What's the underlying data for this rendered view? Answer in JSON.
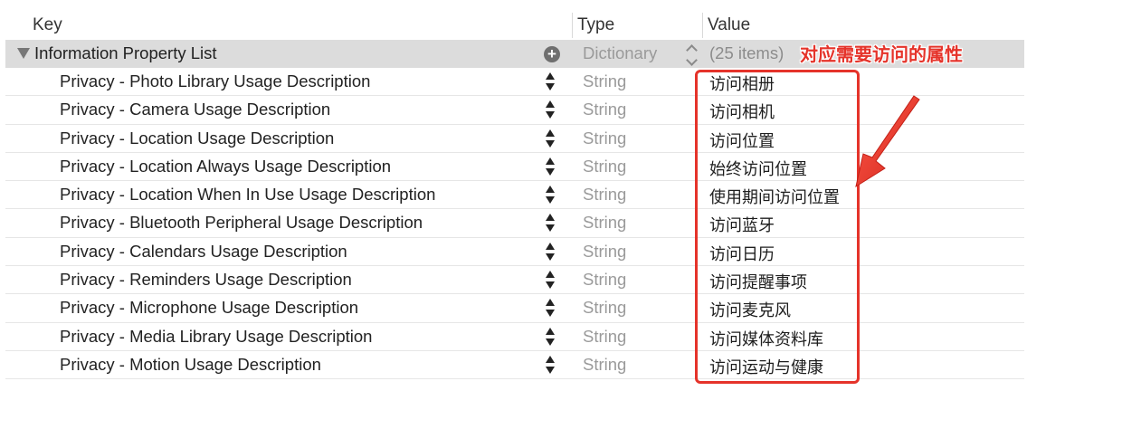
{
  "header": {
    "key": "Key",
    "type": "Type",
    "value": "Value"
  },
  "root": {
    "key": "Information Property List",
    "type": "Dictionary",
    "value": "(25 items)",
    "add_icon": "plus-circle-icon",
    "disclosure_icon": "disclosure-triangle-down-icon"
  },
  "rows": [
    {
      "key": "Privacy - Photo Library Usage Description",
      "type": "String",
      "value": "访问相册"
    },
    {
      "key": "Privacy - Camera Usage Description",
      "type": "String",
      "value": "访问相机"
    },
    {
      "key": "Privacy - Location Usage Description",
      "type": "String",
      "value": "访问位置"
    },
    {
      "key": "Privacy - Location Always Usage Description",
      "type": "String",
      "value": "始终访问位置"
    },
    {
      "key": "Privacy - Location When In Use Usage Description",
      "type": "String",
      "value": "使用期间访问位置"
    },
    {
      "key": "Privacy - Bluetooth Peripheral Usage Description",
      "type": "String",
      "value": "访问蓝牙"
    },
    {
      "key": "Privacy - Calendars Usage Description",
      "type": "String",
      "value": "访问日历"
    },
    {
      "key": "Privacy - Reminders Usage Description",
      "type": "String",
      "value": "访问提醒事项"
    },
    {
      "key": "Privacy - Microphone Usage Description",
      "type": "String",
      "value": "访问麦克风"
    },
    {
      "key": "Privacy - Media Library Usage Description",
      "type": "String",
      "value": "访问媒体资料库"
    },
    {
      "key": "Privacy - Motion Usage Description",
      "type": "String",
      "value": "访问运动与健康"
    }
  ],
  "annotation": {
    "label": "对应需要访问的属性",
    "color": "#e5332a"
  }
}
